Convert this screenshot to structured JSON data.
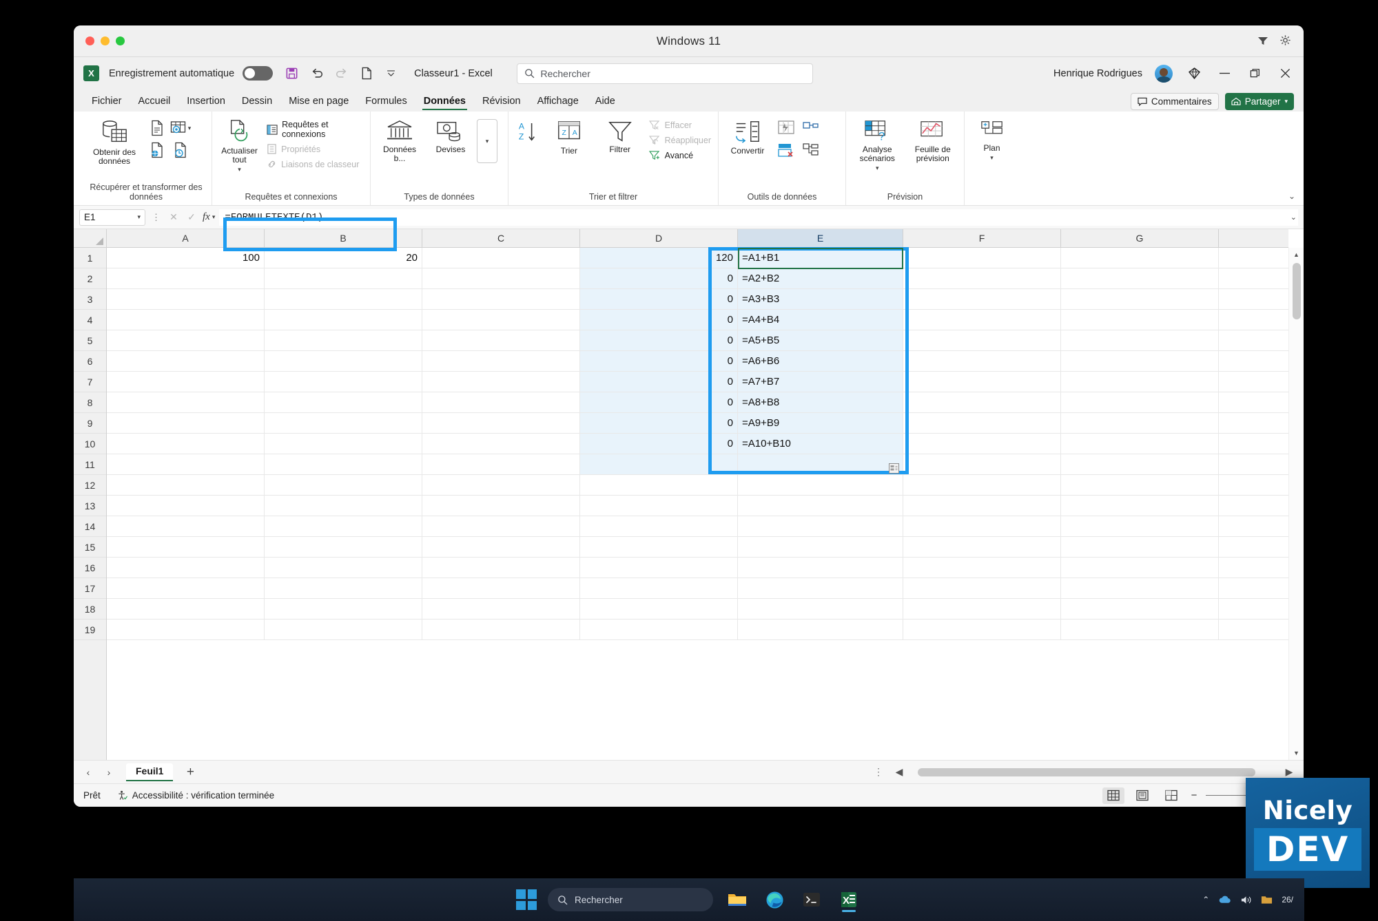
{
  "mac_window": {
    "title": "Windows 11",
    "right_icons": [
      "filter-icon",
      "gear-icon"
    ]
  },
  "excel": {
    "autosave_label": "Enregistrement automatique",
    "document_name": "Classeur1  -  Excel",
    "search_placeholder": "Rechercher",
    "user_name": "Henrique Rodrigues",
    "quick_access": [
      "save-icon",
      "undo-icon",
      "redo-icon",
      "new-icon",
      "customize-qat-chevron"
    ],
    "window_buttons": [
      "minimize",
      "restore",
      "close"
    ],
    "tabs": [
      {
        "label": "Fichier",
        "active": false
      },
      {
        "label": "Accueil",
        "active": false
      },
      {
        "label": "Insertion",
        "active": false
      },
      {
        "label": "Dessin",
        "active": false
      },
      {
        "label": "Mise en page",
        "active": false
      },
      {
        "label": "Formules",
        "active": false
      },
      {
        "label": "Données",
        "active": true
      },
      {
        "label": "Révision",
        "active": false
      },
      {
        "label": "Affichage",
        "active": false
      },
      {
        "label": "Aide",
        "active": false
      }
    ],
    "comments_label": "Commentaires",
    "share_label": "Partager",
    "ribbon": {
      "groups": [
        {
          "name": "Récupérer et transformer des données",
          "big": [
            {
              "label": "Obtenir des données",
              "icon": "get-data-icon",
              "chevron": true
            }
          ],
          "small_icons": [
            "from-text-icon",
            "from-table-icon",
            "from-web-icon",
            "from-recent-icon"
          ]
        },
        {
          "name": "Requêtes et connexions",
          "big": [
            {
              "label": "Actualiser tout",
              "icon": "refresh-all-icon",
              "chevron": true
            }
          ],
          "rows": [
            {
              "label": "Requêtes et connexions",
              "icon": "queries-icon",
              "dim": false
            },
            {
              "label": "Propriétés",
              "icon": "properties-icon",
              "dim": true
            },
            {
              "label": "Liaisons de classeur",
              "icon": "workbook-links-icon",
              "dim": true
            }
          ]
        },
        {
          "name": "Types de données",
          "big": [
            {
              "label": "Données b...",
              "icon": "stocks-icon"
            },
            {
              "label": "Devises",
              "icon": "currencies-icon"
            }
          ],
          "more": "data-types-more-chevron"
        },
        {
          "name": "Trier et filtrer",
          "big": [
            {
              "label": "A→Z",
              "icon": "sort-az-icon"
            },
            {
              "label": "Z→A",
              "icon": "sort-za-icon"
            },
            {
              "label": "Trier",
              "icon": "sort-icon"
            },
            {
              "label": "Filtrer",
              "icon": "filter-icon"
            }
          ],
          "rows": [
            {
              "label": "Effacer",
              "icon": "clear-filter-icon",
              "dim": true
            },
            {
              "label": "Réappliquer",
              "icon": "reapply-icon",
              "dim": true
            },
            {
              "label": "Avancé",
              "icon": "advanced-icon",
              "dim": false
            }
          ]
        },
        {
          "name": "Outils de données",
          "big": [
            {
              "label": "Convertir",
              "icon": "text-to-columns-icon"
            }
          ],
          "small_icons": [
            "flash-fill-icon",
            "remove-duplicates-icon",
            "data-validation-icon",
            "consolidate-icon",
            "relationships-icon"
          ]
        },
        {
          "name": "Prévision",
          "big": [
            {
              "label": "Analyse scénarios",
              "icon": "what-if-icon",
              "chevron": true
            },
            {
              "label": "Feuille de prévision",
              "icon": "forecast-sheet-icon"
            }
          ]
        },
        {
          "name": "",
          "big": [
            {
              "label": "Plan",
              "icon": "outline-icon",
              "chevron": true
            }
          ]
        }
      ],
      "collapse_icon": "collapse-ribbon-chevron"
    },
    "formula_bar": {
      "name_box": "E1",
      "cancel_icon": "cancel-icon",
      "enter_icon": "enter-icon",
      "fx_icon": "insert-function-icon",
      "value": "=FORMULETEXTE(D1)"
    },
    "sheet": {
      "columns": [
        "A",
        "B",
        "C",
        "D",
        "E",
        "F",
        "G"
      ],
      "selected_column": "E",
      "rows": [
        1,
        2,
        3,
        4,
        5,
        6,
        7,
        8,
        9,
        10,
        11,
        12,
        13,
        14,
        15,
        16,
        17,
        18,
        19
      ],
      "cells": {
        "A1": "100",
        "B1": "20",
        "D": [
          "120",
          "0",
          "0",
          "0",
          "0",
          "0",
          "0",
          "0",
          "0",
          "0"
        ],
        "E": [
          "=A1+B1",
          "=A2+B2",
          "=A3+B3",
          "=A4+B4",
          "=A5+B5",
          "=A6+B6",
          "=A7+B7",
          "=A8+B8",
          "=A9+B9",
          "=A10+B10"
        ]
      },
      "active_cell": "E1",
      "selection_range": "E1:E11",
      "fill_handle_icon": "autofill-options-icon"
    },
    "sheet_tabs": {
      "prev_icon": "prev-sheet-icon",
      "next_icon": "next-sheet-icon",
      "tabs": [
        "Feuil1"
      ],
      "add_label": "+"
    },
    "status_bar": {
      "ready": "Prêt",
      "accessibility": "Accessibilité : vérification terminée",
      "accessibility_icon": "accessibility-icon",
      "views": [
        "normal-view-icon",
        "page-layout-icon",
        "page-break-icon"
      ],
      "active_view": "normal-view-icon",
      "zoom_minus": "−",
      "zoom_plus": "+"
    }
  },
  "taskbar": {
    "start_icon": "windows-start-icon",
    "search_placeholder": "Rechercher",
    "apps": [
      "file-explorer-icon",
      "edge-icon",
      "terminal-icon",
      "excel-icon"
    ],
    "active_app": "excel-icon",
    "tray": [
      "chevron-up-icon",
      "onedrive-icon",
      "volume-icon",
      "folder-tray-icon"
    ],
    "date": "26/"
  },
  "watermark": {
    "line1": "Nicely",
    "line2": "DEV"
  },
  "colors": {
    "accent_green": "#217346",
    "selection_blue": "#1e9cf0",
    "selected_fill": "#e8f3fb"
  }
}
